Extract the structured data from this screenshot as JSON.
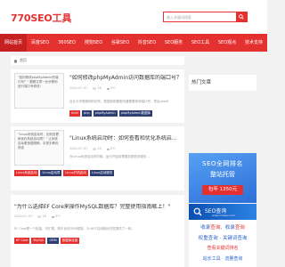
{
  "site": {
    "logo": "770SEO工具",
    "accent": "#e53030",
    "nav_active_bg": "#c62020"
  },
  "search": {
    "placeholder": "输入关键词搜索",
    "icon": "search-icon"
  },
  "nav": [
    "网站首页",
    "百度SEO",
    "360SEO",
    "搜狗SEO",
    "谷歌SEO",
    "抖音SEO",
    "SEO服务",
    "SEO工具",
    "SEO观点",
    "技术支持"
  ],
  "breadcrumb": {
    "icon": "home-icon",
    "label": "首页"
  },
  "articles": [
    {
      "thumb_text": "\"如何修改phpMyAdmin的端口号？\" 跟着文章一步步教你进行端口号修改！",
      "title": "\"如何修改phpMyAdmin访问数据库的端口号？\"",
      "date": "2024-07-07",
      "views": "26",
      "likes": "0℃",
      "excerpt": "百业与华联服饰的初托，数据库配置服务器需要修改端口号，导出phpM",
      "tags": [
        "html",
        "php",
        "phpMyAdmin",
        "phpMyAdmin数据库"
      ]
    },
    {
      "thumb_text": "\"Linux系统启动时，如何查看和优化系统启动项？\" 让系统启动更快更顺畅，手把手教你排查",
      "title": "\"Linux系统启动时：如何查看和优化系统启...",
      "date": "2024-07-07",
      "views": "25",
      "likes": "0℃",
      "excerpt": "在Linux系统启动的时候，运行开始前需要加载很多服务...",
      "tags": [
        "Linux系统启动",
        "Linux启动项",
        "Linux开机启动",
        "Linux启动服务"
      ]
    },
    {
      "title": "\"为什么选择EF Core来操作MySQL数据库？完整使用指南献上！\"",
      "date": "2024-07-07",
      "views": "26",
      "likes": "0℃",
      "excerpt": "EF Core是一个轻量、可扩展、跨平台的ORM框架，为.NET应用程序开发提供了一种...",
      "tags": [
        "EF Core",
        "MySQL",
        "ORM",
        "数据库连接"
      ]
    }
  ],
  "sidebar": {
    "hot_title": "热门文章",
    "ad1": {
      "line1": "SEO全网排名",
      "line2": "整站托管",
      "price": "包年 1350元"
    },
    "ad2": {
      "banner_title": "SEO查询",
      "banner_url": "www.114seo.com",
      "line1_a": "收录",
      "line1_b": "查询",
      "line1_c": "收录",
      "line1_d": "查询",
      "line2": "权重查询 · 关键词查询",
      "line3": "查看关键词排名",
      "line4": "站长工具 · 流量查询"
    }
  }
}
